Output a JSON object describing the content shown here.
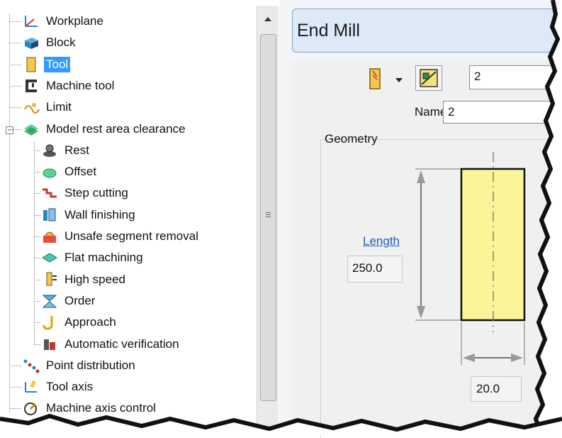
{
  "tree": {
    "items": [
      {
        "label": "Workplane",
        "icon": "workplane-icon",
        "level": 0
      },
      {
        "label": "Block",
        "icon": "block-icon",
        "level": 0
      },
      {
        "label": "Tool",
        "icon": "tool-icon",
        "level": 0,
        "selected": true
      },
      {
        "label": "Machine tool",
        "icon": "machine-tool-icon",
        "level": 0
      },
      {
        "label": "Limit",
        "icon": "limit-icon",
        "level": 0
      },
      {
        "label": "Model rest area clearance",
        "icon": "model-rest-icon",
        "level": 0,
        "expanded": true
      },
      {
        "label": "Rest",
        "icon": "rest-icon",
        "level": 1
      },
      {
        "label": "Offset",
        "icon": "offset-icon",
        "level": 1
      },
      {
        "label": "Step cutting",
        "icon": "step-cutting-icon",
        "level": 1
      },
      {
        "label": "Wall finishing",
        "icon": "wall-finishing-icon",
        "level": 1
      },
      {
        "label": "Unsafe segment removal",
        "icon": "unsafe-segment-icon",
        "level": 1
      },
      {
        "label": "Flat machining",
        "icon": "flat-machining-icon",
        "level": 1
      },
      {
        "label": "High speed",
        "icon": "high-speed-icon",
        "level": 1
      },
      {
        "label": "Order",
        "icon": "order-icon",
        "level": 1
      },
      {
        "label": "Approach",
        "icon": "approach-icon",
        "level": 1
      },
      {
        "label": "Automatic verification",
        "icon": "verification-icon",
        "level": 1
      },
      {
        "label": "Point distribution",
        "icon": "point-distribution-icon",
        "level": 0
      },
      {
        "label": "Tool axis",
        "icon": "tool-axis-icon",
        "level": 0
      },
      {
        "label": "Machine axis control",
        "icon": "machine-axis-icon",
        "level": 0
      }
    ]
  },
  "panel": {
    "title": "End Mill",
    "tool_number": "2",
    "name_label": "Name",
    "name_value": "2",
    "geometry_label": "Geometry",
    "length_label": "Length",
    "length_value": "250.0",
    "diameter_value": "20.0"
  },
  "colors": {
    "selection": "#3399ff",
    "title_bar": "#dde9f7",
    "tool_body": "#fbf59a",
    "link": "#1f5fb8"
  }
}
